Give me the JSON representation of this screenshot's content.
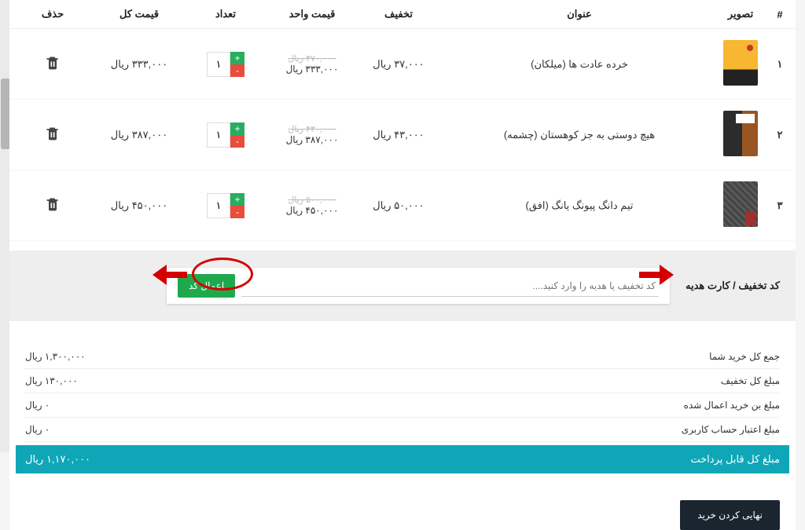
{
  "headers": {
    "num": "#",
    "img": "تصویر",
    "title": "عنوان",
    "discount": "تخفیف",
    "unit": "قیمت واحد",
    "qty": "تعداد",
    "total": "قیمت کل",
    "del": "حذف"
  },
  "currency": "ریال",
  "items": [
    {
      "num": "۱",
      "title": "خرده عادت ها (میلکان)",
      "discount": "۳۷,۰۰۰",
      "unit_old": "۳۷۰,۰۰۰",
      "unit": "۳۳۳,۰۰۰",
      "qty": "۱",
      "total": "۳۳۳,۰۰۰"
    },
    {
      "num": "۲",
      "title": "هیچ دوستی به جز کوهستان (چشمه)",
      "discount": "۴۳,۰۰۰",
      "unit_old": "۴۳۰,۰۰۰",
      "unit": "۳۸۷,۰۰۰",
      "qty": "۱",
      "total": "۳۸۷,۰۰۰"
    },
    {
      "num": "۳",
      "title": "تیم دانگ پیونگ یانگ (افق)",
      "discount": "۵۰,۰۰۰",
      "unit_old": "۵۰۰,۰۰۰",
      "unit": "۴۵۰,۰۰۰",
      "qty": "۱",
      "total": "۴۵۰,۰۰۰"
    }
  ],
  "coupon": {
    "label": "کد تخفیف / کارت هدیه",
    "placeholder": "کد تخفیف یا هدیه را وارد کنید....",
    "apply": "اعمال کد"
  },
  "summary": {
    "rows": [
      {
        "label": "جمع کل خرید شما",
        "value": "۱,۳۰۰,۰۰۰"
      },
      {
        "label": "مبلغ کل تخفیف",
        "value": "۱۳۰,۰۰۰"
      },
      {
        "label": "مبلغ بن خرید اعمال شده",
        "value": "۰"
      },
      {
        "label": "مبلغ اعتبار حساب کاربری",
        "value": "۰"
      }
    ],
    "payable_label": "مبلغ کل قابل پرداخت",
    "payable_value": "۱,۱۷۰,۰۰۰"
  },
  "checkout": "نهایی کردن خرید"
}
